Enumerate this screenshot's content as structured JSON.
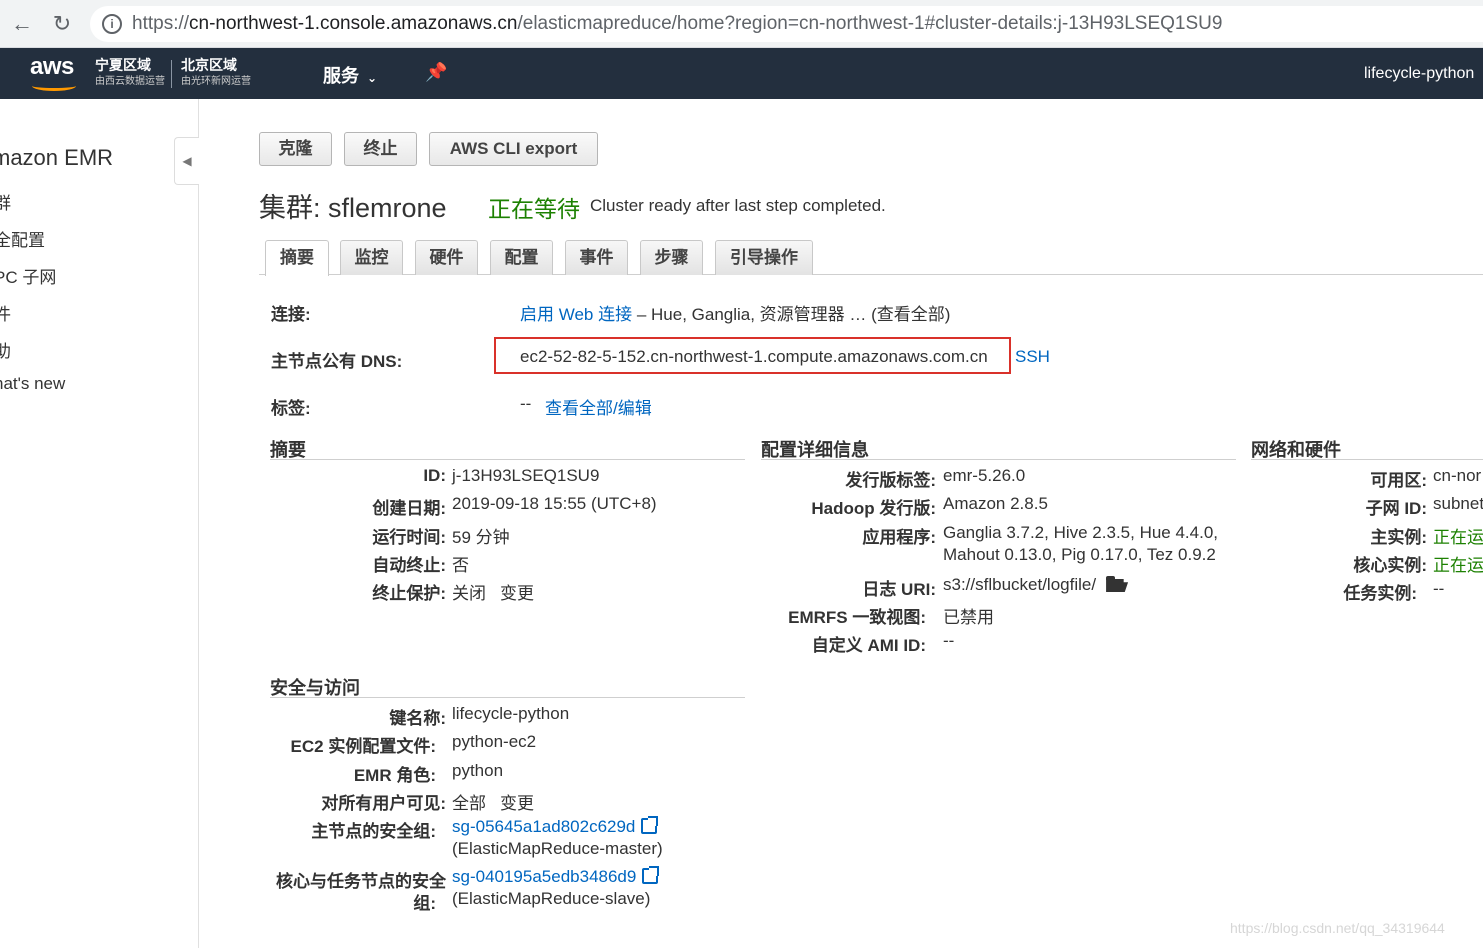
{
  "browser": {
    "back": "←",
    "reload": "↻",
    "info": "i",
    "url_prefix": "https://",
    "url_host": "cn-northwest-1.console.amazonaws.cn",
    "url_path": "/elasticmapreduce/home?region=cn-northwest-1#cluster-details:j-13H93LSEQ1SU9"
  },
  "header": {
    "logo": "aws",
    "region1_name": "宁夏区域",
    "region1_sub": "由西云数据运营",
    "region2_name": "北京区域",
    "region2_sub": "由光环新网运营",
    "services": "服务",
    "services_caret": "⌄",
    "pin": "📌",
    "user": "lifecycle-python"
  },
  "sidebar": {
    "collapse": "◀",
    "title": "mazon EMR",
    "items": [
      "群",
      "全配置",
      "PC 子网",
      "件",
      "助",
      "hat's new"
    ]
  },
  "actions": {
    "clone": "克隆",
    "terminate": "终止",
    "cli_export": "AWS CLI export"
  },
  "cluster": {
    "title": "集群: sflemrone",
    "status": "正在等待",
    "message": "Cluster ready after last step completed."
  },
  "tabs": [
    "摘要",
    "监控",
    "硬件",
    "配置",
    "事件",
    "步骤",
    "引导操作"
  ],
  "overview": {
    "connect_label": "连接:",
    "connect_link": "启用 Web 连接",
    "connect_rest": "– Hue, Ganglia, 资源管理器 … (查看全部)",
    "dns_label": "主节点公有 DNS:",
    "dns_value": "ec2-52-82-5-152.cn-northwest-1.compute.amazonaws.com.cn",
    "ssh": "SSH",
    "tags_label": "标签:",
    "tags_value": "--",
    "tags_link": "查看全部/编辑"
  },
  "summary": {
    "title": "摘要",
    "id_label": "ID:",
    "id": "j-13H93LSEQ1SU9",
    "created_label": "创建日期:",
    "created": "2019-09-18 15:55 (UTC+8)",
    "elapsed_label": "运行时间:",
    "elapsed": "59 分钟",
    "autoterm_label": "自动终止:",
    "autoterm": "否",
    "protect_label": "终止保护:",
    "protect": "关闭",
    "protect_change": "变更"
  },
  "config": {
    "title": "配置详细信息",
    "release_label": "发行版标签:",
    "release": "emr-5.26.0",
    "hadoop_label": "Hadoop 发行版:",
    "hadoop": "Amazon 2.8.5",
    "apps_label": "应用程序:",
    "apps_line1": "Ganglia 3.7.2, Hive 2.3.5, Hue 4.4.0,",
    "apps_line2": "Mahout 0.13.0, Pig 0.17.0, Tez 0.9.2",
    "log_label": "日志 URI:",
    "log": "s3://sflbucket/logfile/",
    "emrfs_label": "EMRFS 一致视图:",
    "emrfs": "已禁用",
    "ami_label": "自定义 AMI ID:",
    "ami": "--"
  },
  "network": {
    "title": "网络和硬件",
    "az_label": "可用区:",
    "az": "cn-nor",
    "subnet_label": "子网 ID:",
    "subnet": "subnet",
    "master_label": "主实例:",
    "master": "正在运",
    "core_label": "核心实例:",
    "core": "正在运",
    "task_label": "任务实例:",
    "task": "--"
  },
  "security": {
    "title": "安全与访问",
    "key_label": "键名称:",
    "key": "lifecycle-python",
    "profile_label": "EC2 实例配置文件:",
    "profile": "python-ec2",
    "role_label": "EMR 角色:",
    "role": "python",
    "visible_label": "对所有用户可见:",
    "visible": "全部",
    "visible_change": "变更",
    "master_sg_label": "主节点的安全组:",
    "master_sg": "sg-05645a1ad802c629d",
    "master_sg_name": "(ElasticMapReduce-master)",
    "slave_sg_label_1": "核心与任务节点的安全",
    "slave_sg_label_2": "组:",
    "slave_sg": "sg-040195a5edb3486d9",
    "slave_sg_name": "(ElasticMapReduce-slave)"
  },
  "watermark": "https://blog.csdn.net/qq_34319644"
}
